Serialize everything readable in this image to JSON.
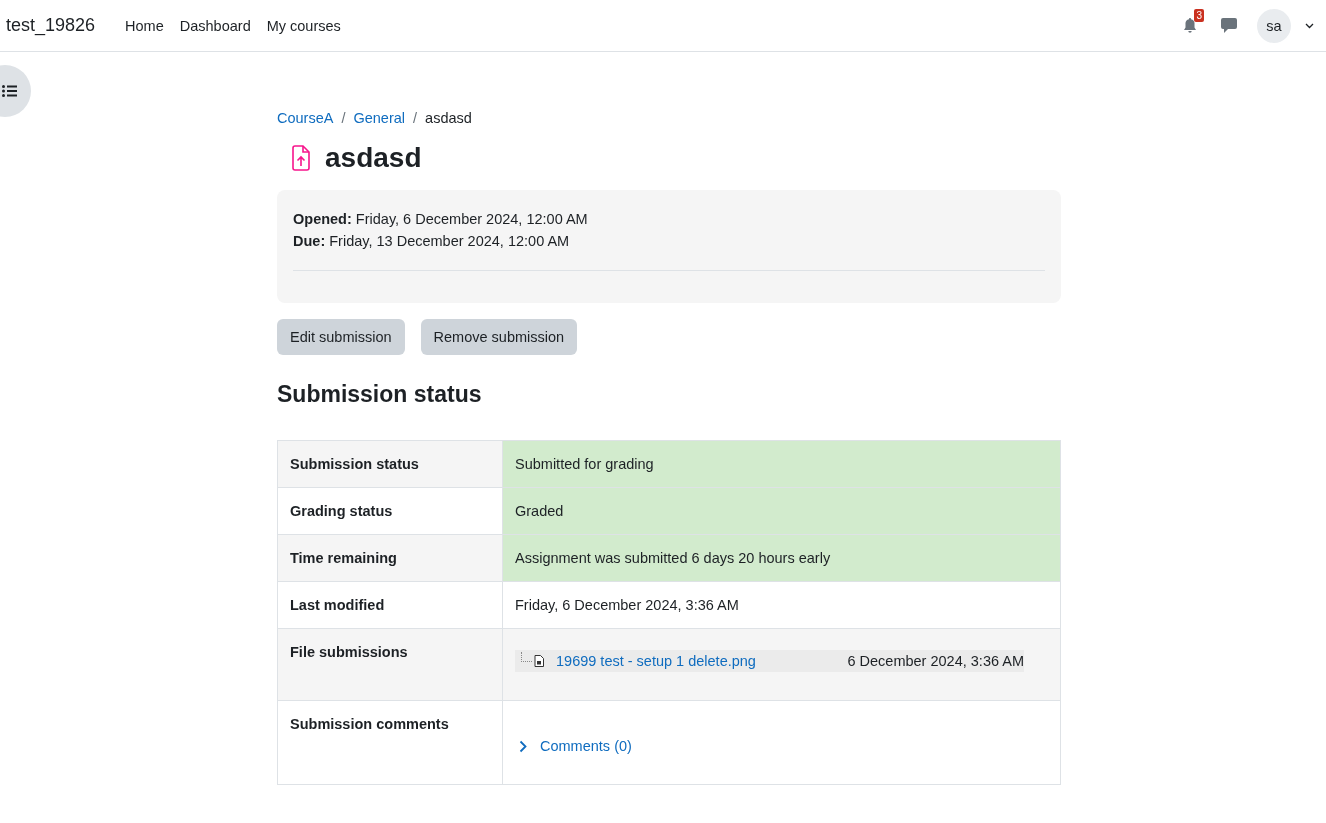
{
  "navbar": {
    "site_name": "test_19826",
    "links": [
      "Home",
      "Dashboard",
      "My courses"
    ],
    "notification_count": "3",
    "avatar": "sa"
  },
  "breadcrumb": [
    {
      "label": "CourseA",
      "link": true
    },
    {
      "separator": "/",
      "label": "General",
      "link": true
    },
    {
      "separator": "/",
      "label": "asdasd",
      "link": false
    }
  ],
  "title": "asdasd",
  "dates": [
    {
      "label": "Opened:",
      "value": "Friday, 6 December 2024, 12:00 AM"
    },
    {
      "label": "Due:",
      "value": "Friday, 13 December 2024, 12:00 AM"
    }
  ],
  "buttons": [
    "Edit submission",
    "Remove submission"
  ],
  "section_title": "Submission status",
  "table": {
    "rows": [
      {
        "label": "Submission status",
        "kind": "text",
        "value": "Submitted for grading",
        "highlighted": true
      },
      {
        "label": "Grading status",
        "kind": "text",
        "value": "Graded",
        "highlighted": true
      },
      {
        "label": "Time remaining",
        "kind": "text",
        "value": "Assignment was submitted 6 days 20 hours early",
        "highlighted": true
      },
      {
        "label": "Last modified",
        "kind": "text",
        "value": "Friday, 6 December 2024, 3:36 AM",
        "highlighted": false
      },
      {
        "label": "File submissions",
        "kind": "file",
        "file_name": "19699 test - setup 1 delete.png",
        "file_date": "6 December 2024, 3:36 AM",
        "highlighted": false
      },
      {
        "label": "Submission comments",
        "kind": "comments",
        "value": "Comments (0)",
        "expanded": false,
        "highlighted": false
      }
    ]
  }
}
